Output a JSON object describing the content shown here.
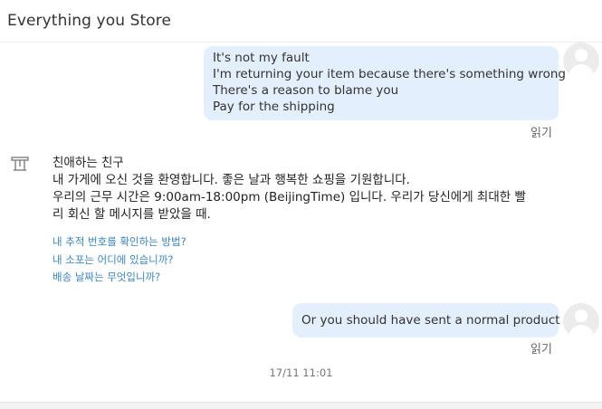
{
  "header": {
    "title": "Everything you Store"
  },
  "messages": {
    "outgoing_1": {
      "lines": [
        "It's not my fault",
        "I'm returning your item because there's something wrong",
        "There's a reason to blame you",
        "Pay for the shipping"
      ],
      "status": "읽기"
    },
    "incoming_1": {
      "icon": "store-icon",
      "lines": [
        "친애하는 친구",
        "내 가게에 오신 것을 환영합니다. 좋은 날과 행복한 쇼핑을 기원합니다.",
        "우리의 근무 시간은 9:00am-18:00pm (BeijingTime) 입니다. 우리가 당신에게 최대한 빨",
        "리 회신 할 메시지를 받았을 때."
      ],
      "faq": [
        "내 추적 번호를 확인하는 방법?",
        "내 소포는 어디에 있습니까?",
        "배송 날짜는 무엇입니까?"
      ]
    },
    "outgoing_2": {
      "text": "Or you should have sent a normal product",
      "status": "읽기"
    }
  },
  "timestamp": "17/11 11:01",
  "colors": {
    "outgoing_bubble": "#e3effc",
    "link": "#3a86c8",
    "avatar_bg": "#ececec"
  }
}
